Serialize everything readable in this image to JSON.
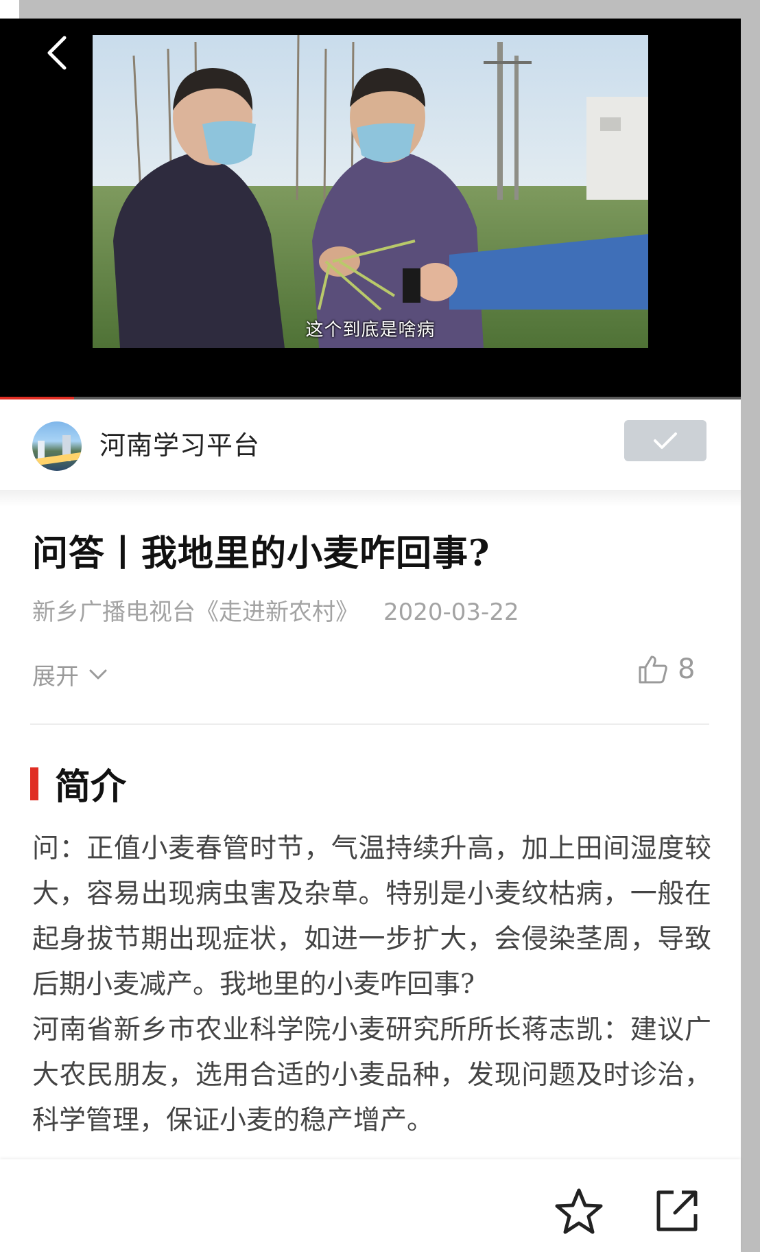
{
  "video": {
    "subtitle": "这个到底是啥病",
    "progress": 0.1
  },
  "publisher": {
    "name": "河南学习平台",
    "follow_state": "followed"
  },
  "article": {
    "title": "问答丨我地里的小麦咋回事?",
    "source": "新乡广播电视台《走进新农村》",
    "date": "2020-03-22",
    "expand_label": "展开",
    "likes": "8"
  },
  "intro": {
    "heading": "简介",
    "paragraphs": [
      "问：正值小麦春管时节，气温持续升高，加上田间湿度较大，容易出现病虫害及杂草。特别是小麦纹枯病，一般在起身拔节期出现症状，如进一步扩大，会侵染茎周，导致后期小麦减产。我地里的小麦咋回事?",
      "河南省新乡市农业科学院小麦研究所所长蒋志凯：建议广大农民朋友，选用合适的小麦品种，发现问题及时诊治，科学管理，保证小麦的稳产增产。"
    ]
  },
  "icons": {
    "back": "chevron-left-icon",
    "follow": "check-icon",
    "expand": "chevron-down-icon",
    "like": "thumbs-up-icon",
    "favorite": "star-icon",
    "share": "share-icon"
  },
  "colors": {
    "accent": "#e02e24",
    "follow_button": "#ccd1d6",
    "meta_text": "#a3a3a3"
  }
}
